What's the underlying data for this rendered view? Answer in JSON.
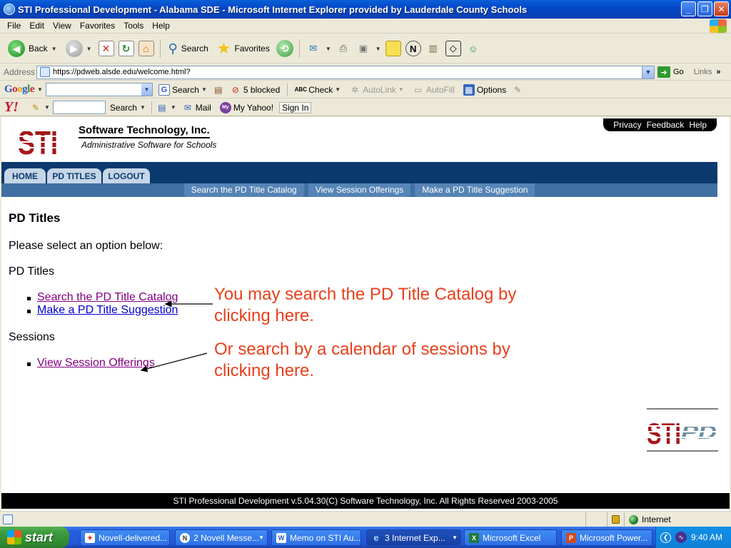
{
  "window": {
    "title": "STI Professional Development - Alabama SDE - Microsoft Internet Explorer provided by Lauderdale County Schools",
    "minimize": "_",
    "maximize": "❐",
    "close": "✕"
  },
  "menu": [
    "File",
    "Edit",
    "View",
    "Favorites",
    "Tools",
    "Help"
  ],
  "toolbar": {
    "back_label": "Back",
    "search_label": "Search",
    "favorites_label": "Favorites"
  },
  "address": {
    "label": "Address",
    "url": "https://pdweb.alsde.edu/welcome.html?",
    "go_label": "Go",
    "links_label": "Links",
    "links_chevron": "»"
  },
  "google_toolbar": {
    "logo": [
      "G",
      "o",
      "o",
      "g",
      "l",
      "e"
    ],
    "search_label": "Search",
    "blocked_label": "5 blocked",
    "check_label": "Check",
    "autolink_label": "AutoLink",
    "autofill_label": "AutoFill",
    "options_label": "Options"
  },
  "yahoo_toolbar": {
    "logo": "Y!",
    "search_label": "Search",
    "mail_label": "Mail",
    "my_yahoo_label": "My Yahoo!",
    "sign_in_label": "Sign In"
  },
  "page": {
    "logo_text": "STI",
    "company_name": "Software Technology, Inc.",
    "company_tagline": "Administrative Software for Schools",
    "top_links": [
      "Privacy",
      "Feedback",
      "Help"
    ],
    "tabs": [
      "HOME",
      "PD TITLES",
      "LOGOUT"
    ],
    "subnav": [
      "Search the PD Title Catalog",
      "View Session Offerings",
      "Make a PD Title Suggestion"
    ],
    "heading": "PD Titles",
    "intro": "Please select an option below:",
    "section_pd_titles": "PD Titles",
    "link_search_catalog": "Search the PD Title Catalog",
    "link_make_suggestion": "Make a PD Title Suggestion",
    "section_sessions": "Sessions",
    "link_view_sessions": "View Session Offerings",
    "annotation_1": "You may search the PD Title Catalog by clicking here.",
    "annotation_2": "Or search by a calendar of sessions by clicking here.",
    "stipd_logo": [
      "STI",
      "PD"
    ],
    "footer": "STI Professional Development v.5.04.30(C) Software Technology, Inc. All Rights Reserved 2003-2005"
  },
  "status": {
    "zone": "Internet"
  },
  "taskbar": {
    "start_label": "start",
    "tasks": [
      "Novell-delivered...",
      "2 Novell Messe...",
      "Memo on STI Au...",
      "3 Internet Exp...",
      "Microsoft Excel",
      "Microsoft Power..."
    ],
    "clock": "9:40 AM"
  },
  "colors": {
    "nav_blue": "#0b3a6e",
    "subnav_blue": "#3f6fa3",
    "annotation": "#e8401c",
    "sti_red": "#a3171b",
    "visited_link": "#800080",
    "link": "#0000cc"
  }
}
